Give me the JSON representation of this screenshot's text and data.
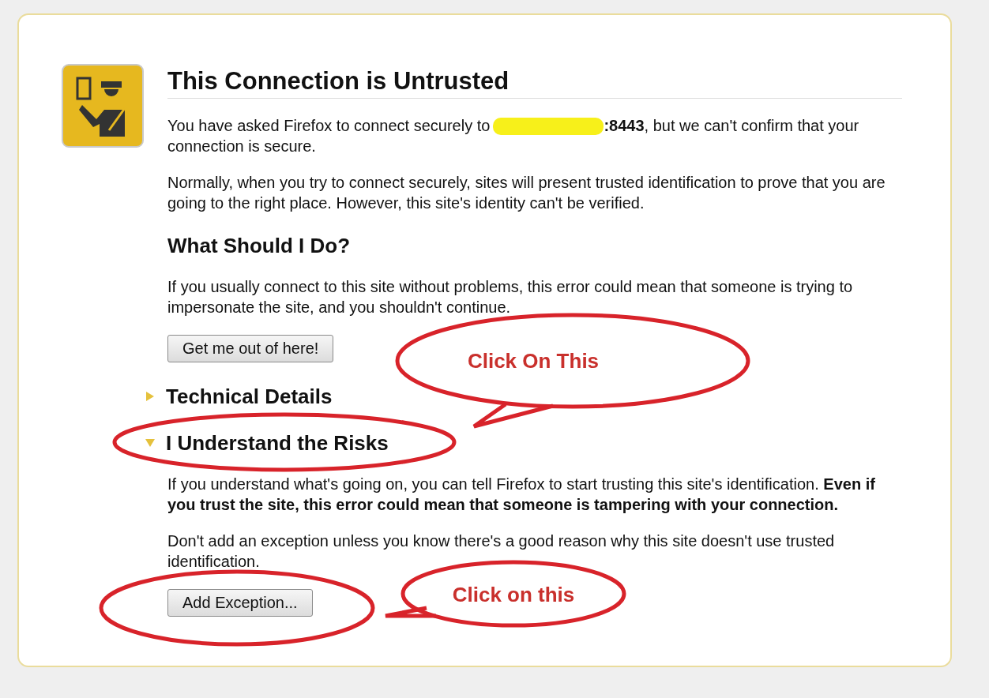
{
  "title": "This Connection is Untrusted",
  "intro": {
    "before": "You have asked Firefox to connect securely to",
    "redacted": true,
    "after": "**:8443**, but we can't confirm that your connection is secure."
  },
  "explanation": "Normally, when you try to connect securely, sites will present trusted identification to prove that you are going to the right place. However, this site's identity can't be verified.",
  "advice": {
    "heading": "What Should I Do?",
    "text": "If you usually connect to this site without problems, this error could mean that someone is trying to impersonate the site, and you shouldn't continue.",
    "button": "Get me out of here!"
  },
  "sections": [
    {
      "heading": "Technical Details",
      "expanded": false
    },
    {
      "heading": "I Understand the Risks",
      "expanded": true,
      "paragraphs": [
        "If you understand what's going on, you can tell Firefox to start trusting this site's identification. **Even if you trust the site, this error could mean that someone is tampering with your connection.**",
        "Don't add an exception unless you know there's a good reason why this site doesn't use trusted identification."
      ],
      "button": "Add Exception..."
    }
  ],
  "annotations": [
    {
      "kind": "callout",
      "label": "Click On This"
    },
    {
      "kind": "ring"
    },
    {
      "kind": "callout",
      "label": "Click on this"
    },
    {
      "kind": "ring"
    }
  ]
}
